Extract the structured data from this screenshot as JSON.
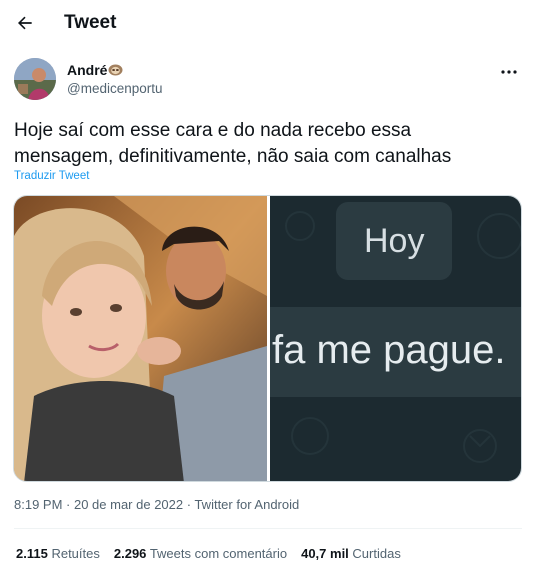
{
  "header": {
    "title": "Tweet",
    "back_icon": "arrow-left-icon"
  },
  "author": {
    "display_name": "André",
    "name_emoji": "sloth-emoji",
    "handle": "@medicenportu"
  },
  "tweet": {
    "text": "Hoje saí com esse cara e do nada recebo essa\nmensagem, definitivamente, não saia com canalhas",
    "translate_label": "Traduzir Tweet"
  },
  "media": {
    "screenshot_word_top": "Hoy",
    "screenshot_message": "fa me pague."
  },
  "meta": {
    "time": "8:19 PM",
    "separator": " · ",
    "date": "20 de mar de 2022",
    "source": "Twitter for Android"
  },
  "stats": {
    "retweets_count": "2.115",
    "retweets_label": "Retuítes",
    "quotes_count": "2.296",
    "quotes_label": "Tweets com comentário",
    "likes_count": "40,7 mil",
    "likes_label": "Curtidas"
  },
  "colors": {
    "link": "#1d9bf0",
    "secondary_text": "#536471",
    "primary_text": "#0f1419"
  }
}
